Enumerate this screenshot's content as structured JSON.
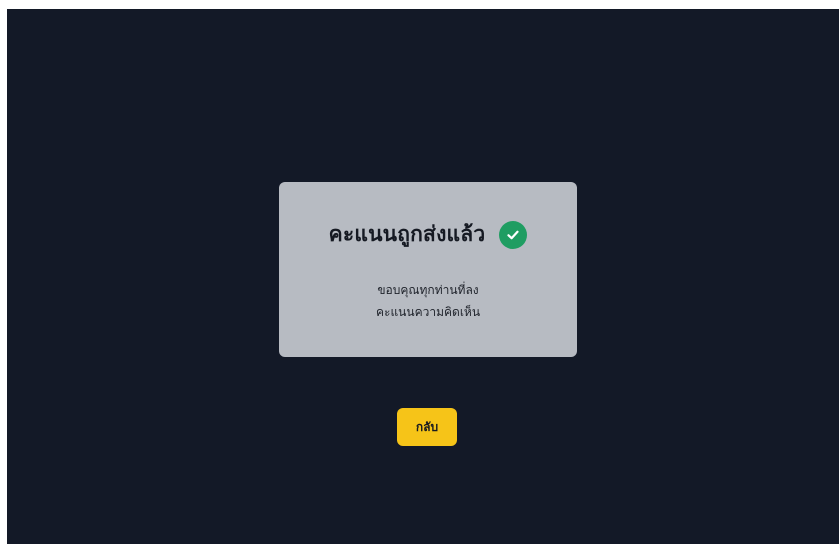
{
  "dialog": {
    "title": "คะแนนถูกส่งแล้ว",
    "status_icon": "check-circle-icon",
    "message_line1": "ขอบคุณทุกท่านที่ลง",
    "message_line2": "คะแนนความคิดเห็น"
  },
  "actions": {
    "back_label": "กลับ"
  },
  "colors": {
    "background": "#131927",
    "card": "#b7bbc2",
    "success": "#1f9d62",
    "button": "#f6c418"
  }
}
